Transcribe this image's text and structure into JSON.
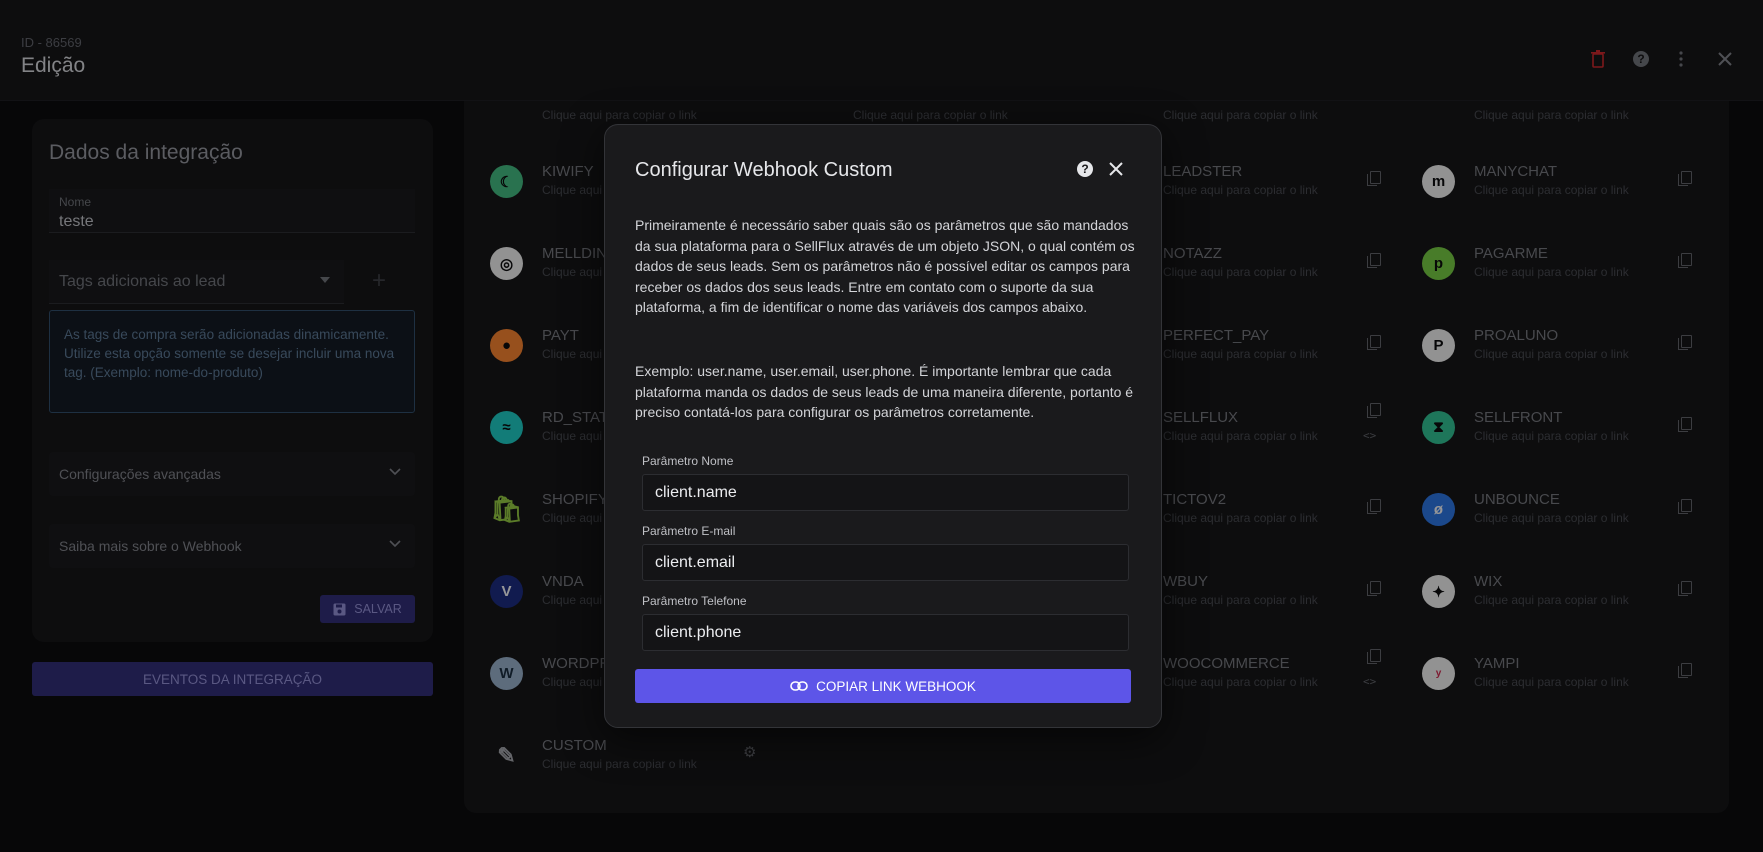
{
  "header": {
    "id_line": "ID - 86569",
    "title": "Edição",
    "icons": [
      "trash-icon",
      "help-icon",
      "more-vertical-icon",
      "close-icon"
    ]
  },
  "left": {
    "section_title": "Dados da integração",
    "name_label": "Nome",
    "name_value": "teste",
    "tags_placeholder": "Tags adicionais ao lead",
    "plus": "+",
    "info_text": "As tags de compra serão adicionadas dinamicamente. Utilize esta opção somente se desejar incluir uma nova tag. (Exemplo: nome-do-produto)",
    "advanced_label": "Configurações avançadas",
    "learn_more_label": "Saiba mais sobre o Webhook",
    "save_label": "SALVAR",
    "events_label": "EVENTOS DA INTEGRAÇÃO"
  },
  "platforms": {
    "copy_text": "Clique aqui para copiar o link",
    "col1": [
      "KIWIFY",
      "MELLDIN",
      "PAYT",
      "RD_STATIO",
      "SHOPIFY",
      "VNDA",
      "WORDPR",
      "CUSTOM"
    ],
    "col3": [
      "LEADSTER",
      "NOTAZZ",
      "PERFECT_PAY",
      "SELLFLUX",
      "TICTOV2",
      "WBUY",
      "WOOCOMMERCE"
    ],
    "col4": [
      "MANYCHAT",
      "PAGARME",
      "PROALUNO",
      "SELLFRONT",
      "UNBOUNCE",
      "WIX",
      "YAMPI"
    ],
    "colors": {
      "kiwify": "#3fb07a",
      "melldin": "#e0e0e0",
      "payt": "#e97b2d",
      "rd": "#1dbfb8",
      "shopify": "#8cbf3f",
      "vnda": "#1b2a7a",
      "wordpress": "#8fa6bf",
      "custom": "#9a9ca2",
      "manychat": "#e0e0e0",
      "pagarme": "#6fbf3f",
      "proaluno": "#e0e0e0",
      "sellfront": "#2fb58a",
      "unbounce": "#2a6fd6",
      "wix": "#e0e0e0",
      "yampi": "#e0e0e0",
      "accent": "#5d55e8"
    }
  },
  "modal": {
    "title": "Configurar Webhook Custom",
    "paragraph1": "Primeiramente é necessário saber quais são os parâmetros que são mandados da sua plataforma para o SellFlux através de um objeto JSON, o qual contém os dados de seus leads. Sem os parâmetros não é possível editar os campos para receber os dados dos seus leads. Entre em contato com o suporte da sua plataforma, a fim de identificar o nome das variáveis dos campos abaixo.",
    "paragraph2": "Exemplo: user.name, user.email, user.phone. É importante lembrar que cada plataforma manda os dados de seus leads de uma maneira diferente, portanto é preciso contatá-los para configurar os parâmetros corretamente.",
    "name_label": "Parâmetro Nome",
    "name_value": "client.name",
    "email_label": "Parâmetro E-mail",
    "email_value": "client.email",
    "phone_label": "Parâmetro Telefone",
    "phone_value": "client.phone",
    "copy_button": "COPIAR LINK WEBHOOK"
  }
}
